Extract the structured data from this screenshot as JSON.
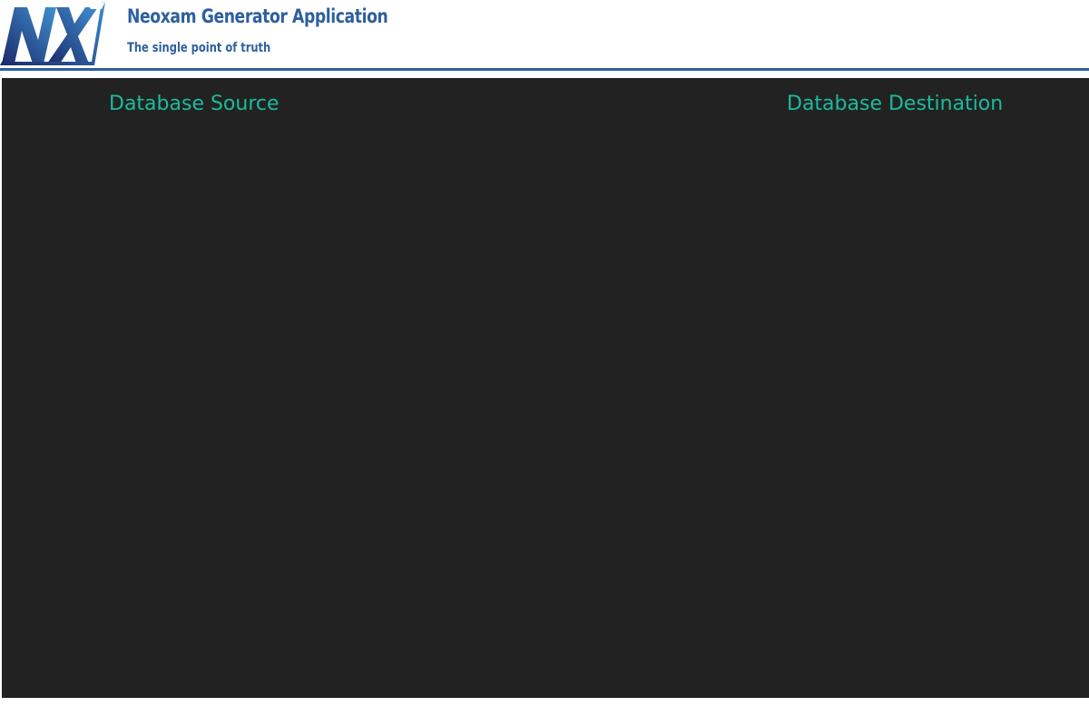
{
  "header": {
    "logo": {
      "text": "NX",
      "icon": "nx-logo-icon"
    },
    "title": "Neoxam Generator Application",
    "subtitle": "The single point of truth"
  },
  "main": {
    "source_heading": "Database Source",
    "destination_heading": "Database Destination"
  },
  "colors": {
    "brand_blue": "#2e5f9e",
    "logo_dark": "#1c2a6b",
    "logo_light": "#3f8fd0",
    "panel_background": "#222222",
    "heading_teal": "#1abc9c",
    "page_background": "#ffffff"
  }
}
